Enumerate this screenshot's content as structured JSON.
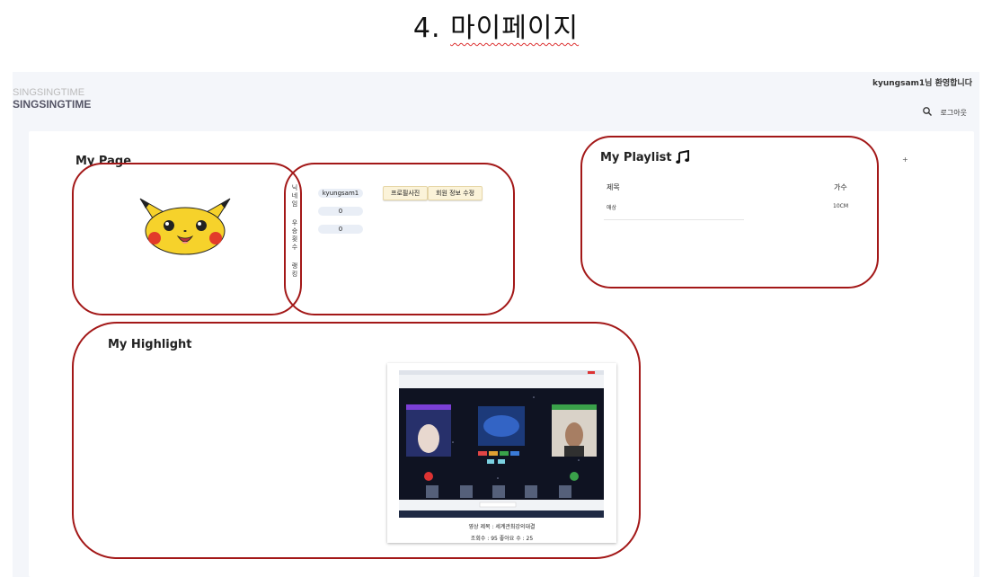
{
  "slide": {
    "number": "4.",
    "title": "마이페이지"
  },
  "header": {
    "logo_top": "SINGSINGTIME",
    "logo_bottom": "SINGSINGTIME",
    "welcome": "kyungsam1님 환영합니다",
    "logout": "로그아웃",
    "search_icon": "search-icon"
  },
  "mypage": {
    "title": "My Page",
    "avatar": "pikachu",
    "labels": [
      "닉",
      "네",
      "임",
      "",
      "우",
      "승",
      "횟",
      "수",
      "",
      "랭",
      "킹"
    ],
    "nickname": "kyungsam1",
    "wins": "0",
    "rank": "0",
    "profile_button": "프로필사진",
    "edit_button": "회원 정보 수정"
  },
  "playlist": {
    "title": "My Playlist",
    "icon": "music-note-icon",
    "col_title": "제목",
    "col_singer": "가수",
    "rows": [
      {
        "title": "애상",
        "singer": "10CM"
      }
    ],
    "plus": "+"
  },
  "highlight": {
    "title": "My Highlight",
    "video_title": "영상 제목 : 세계관최강의대결",
    "video_stats": "조회수 : 95    좋아요 수 : 25"
  },
  "colors": {
    "annotation_ring": "#a31818",
    "page_bg": "#f4f6fa",
    "button_bg": "#fbf3d9"
  }
}
